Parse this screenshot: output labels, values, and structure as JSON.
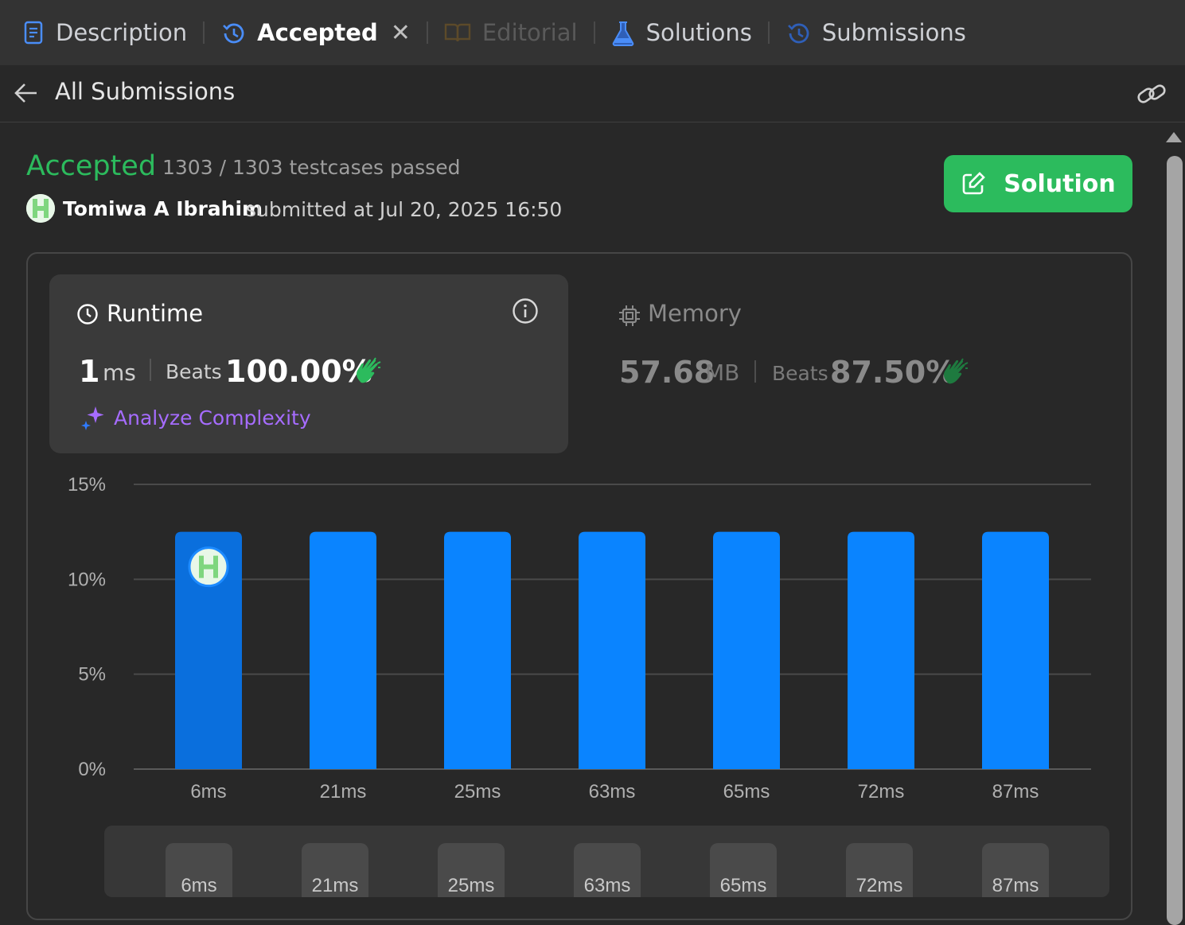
{
  "tabs": [
    {
      "label": "Description",
      "icon": "description-icon",
      "state": "normal"
    },
    {
      "label": "Accepted",
      "icon": "history-icon",
      "state": "active"
    },
    {
      "label": "Editorial",
      "icon": "book-icon",
      "state": "disabled"
    },
    {
      "label": "Solutions",
      "icon": "flask-icon",
      "state": "normal"
    },
    {
      "label": "Submissions",
      "icon": "history-icon",
      "state": "normal"
    }
  ],
  "subheader": {
    "title": "All Submissions"
  },
  "status": {
    "label": "Accepted",
    "testcases": "1303 / 1303 testcases passed",
    "author": "Tomiwa A Ibrahim",
    "submitted": "submitted at Jul 20, 2025 16:50"
  },
  "solution_button": {
    "label": "Solution"
  },
  "runtime": {
    "title": "Runtime",
    "value": "1",
    "unit": "ms",
    "beats_label": "Beats",
    "beats": "100.00%",
    "analyze": "Analyze Complexity"
  },
  "memory": {
    "title": "Memory",
    "value": "57.68",
    "unit": "MB",
    "beats_label": "Beats",
    "beats": "87.50%"
  },
  "colors": {
    "accent_green": "#2cbb5d",
    "bar_blue": "#0a84ff",
    "bar_selected": "#0a6fdd",
    "analyze_purple": "#a66cff"
  },
  "chart_data": {
    "type": "bar",
    "categories": [
      "6ms",
      "21ms",
      "25ms",
      "63ms",
      "65ms",
      "72ms",
      "87ms"
    ],
    "values": [
      12.5,
      12.5,
      12.5,
      12.5,
      12.5,
      12.5,
      12.5
    ],
    "yticks": [
      "0%",
      "5%",
      "10%",
      "15%"
    ],
    "ylim": [
      0,
      15
    ],
    "selected_index": 0,
    "grid": true
  },
  "mini_strip": {
    "labels": [
      "6ms",
      "21ms",
      "25ms",
      "63ms",
      "65ms",
      "72ms",
      "87ms"
    ]
  }
}
